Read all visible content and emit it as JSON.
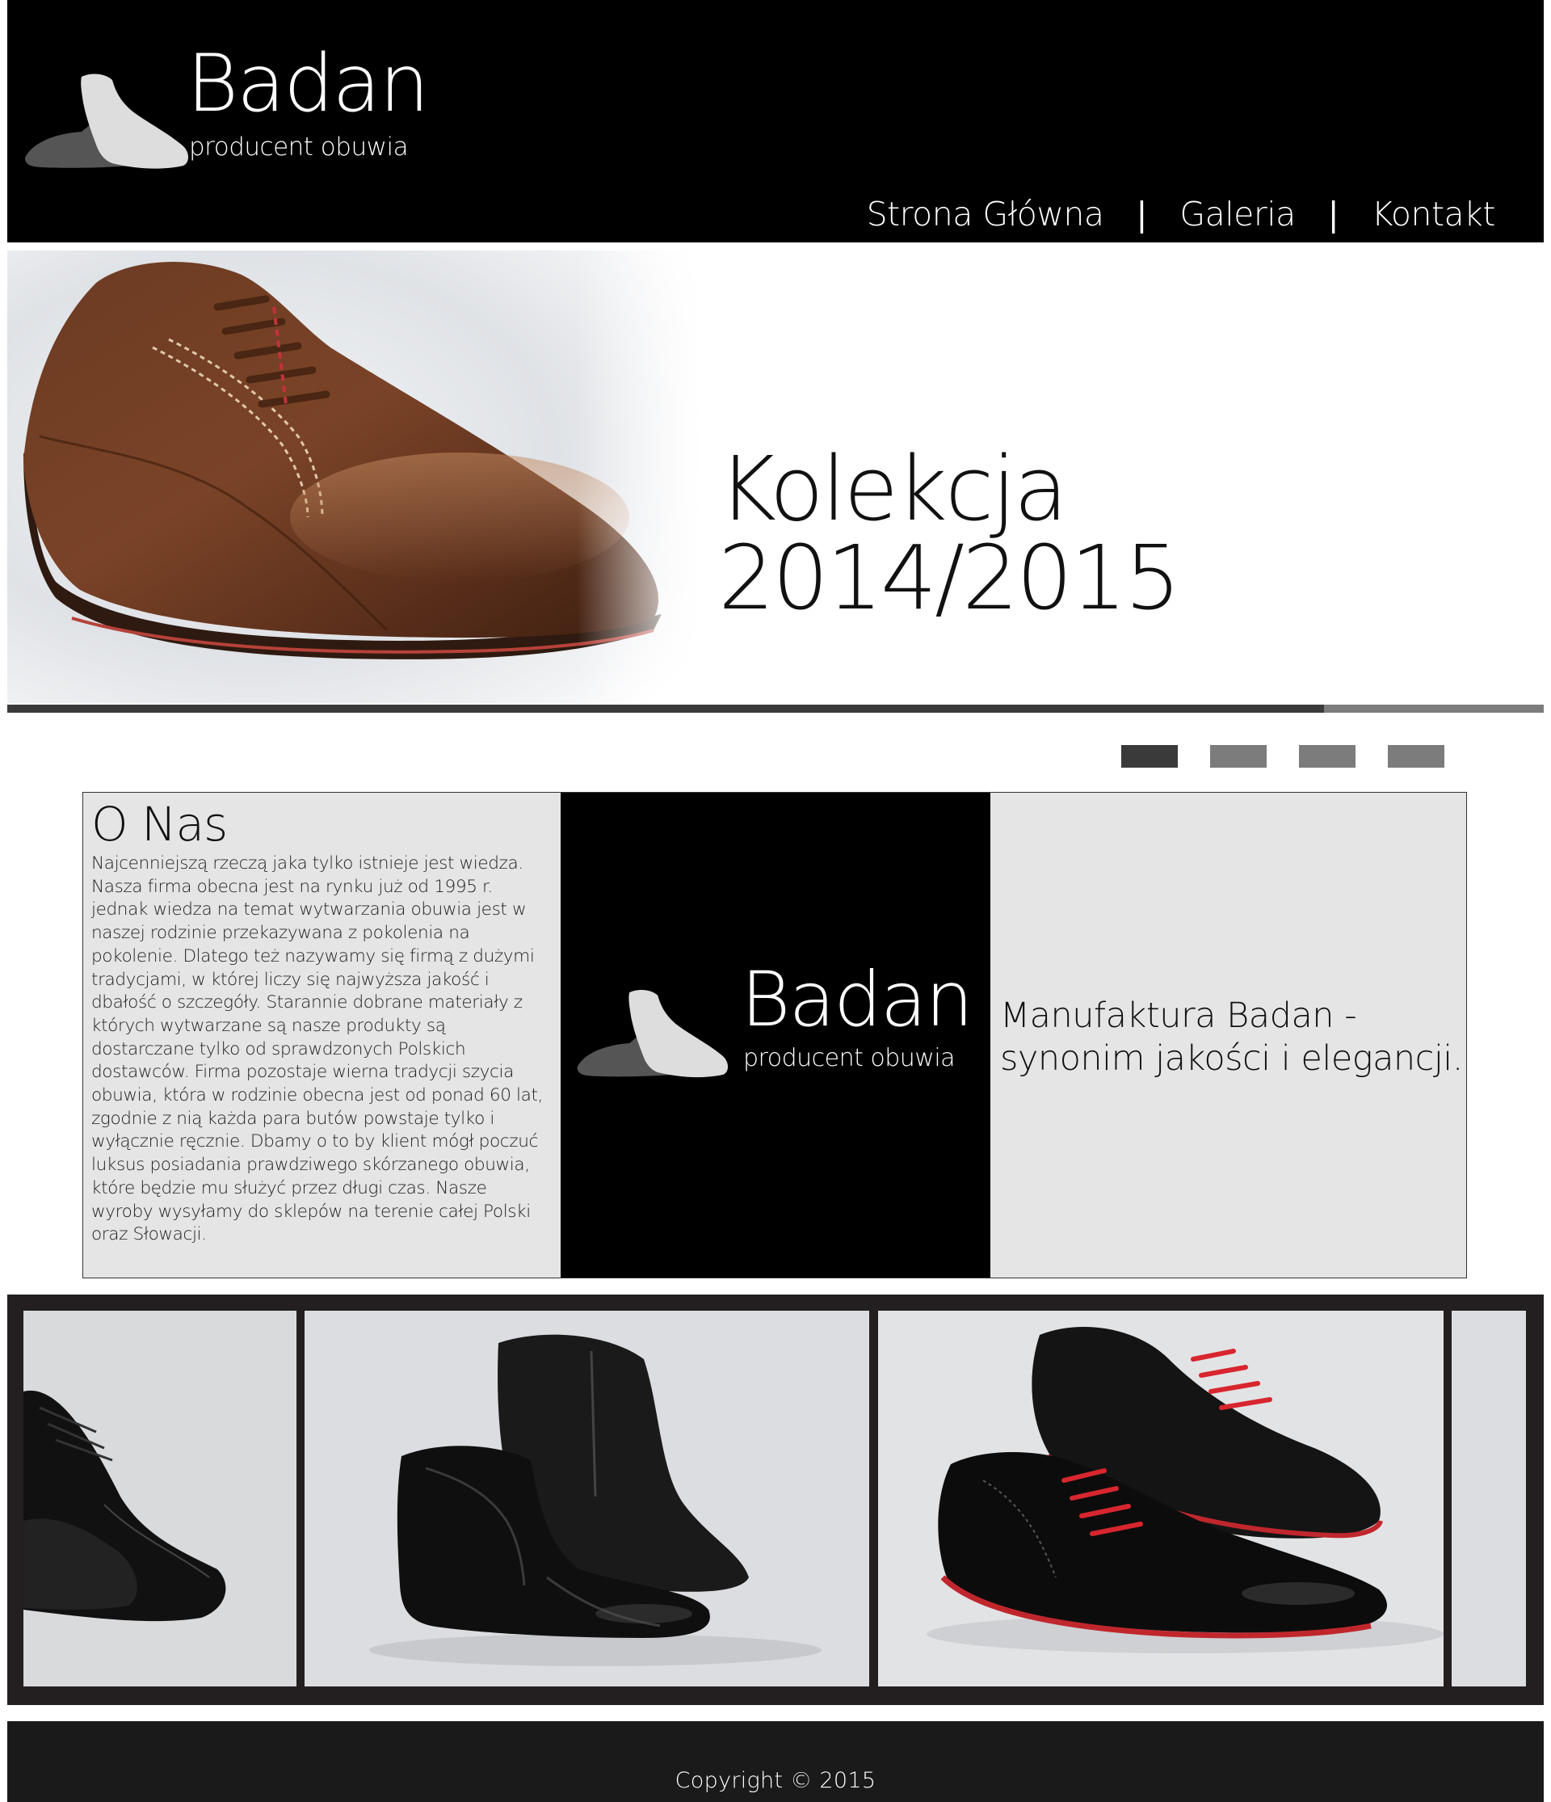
{
  "brand": {
    "name": "Badan",
    "tagline": "producent obuwia"
  },
  "nav": {
    "items": [
      {
        "label": "Strona Główna"
      },
      {
        "label": "Galeria"
      },
      {
        "label": "Kontakt"
      }
    ],
    "separator": "|"
  },
  "hero": {
    "title": "Kolekcja 2014/2015",
    "progress": 0.857
  },
  "slider": {
    "count": 4,
    "active_index": 0
  },
  "about": {
    "heading": "O Nas",
    "text": "Najcenniejszą rzeczą jaka tylko istnieje jest wiedza. Nasza firma obecna jest na rynku już od 1995 r. jednak wiedza na temat wytwarzania obuwia jest w naszej rodzinie przekazywana z pokolenia na pokolenie. Dlatego też nazywamy się firmą z dużymi tradycjami, w której liczy się najwyższa jakość i dbałość o szczegóły. Starannie dobrane materiały z których wytwarzane są nasze produkty są dostarczane tylko od sprawdzonych Polskich dostawców. Firma pozostaje wierna tradycji szycia obuwia, która w rodzinie obecna jest od ponad 60 lat, zgodnie z nią każda para butów powstaje tylko i wyłącznie ręcznie. Dbamy o to by klient mógł poczuć luksus posiadania prawdziwego skórzanego obuwia, które będzie mu służyć przez długi czas. Nasze wyroby wysyłamy do sklepów na terenie całej Polski oraz Słowacji.",
    "slogan_line1": "Manufaktura Badan -",
    "slogan_line2": "synonim jakości i elegancji."
  },
  "gallery": {
    "images": [
      {
        "name": "gallery-image-black-oxford-cropped"
      },
      {
        "name": "gallery-image-black-ankle-boots"
      },
      {
        "name": "gallery-image-black-derby-red-laces"
      },
      {
        "name": "gallery-image-partial"
      }
    ]
  },
  "footer": {
    "copyright": "Copyright © 2015"
  },
  "colors": {
    "header_bg": "#000000",
    "panel_gray": "#e5e5e5",
    "gallery_bg": "#231f20",
    "footer_bg": "#1a1a1a",
    "dot_active": "#3a3a3a",
    "dot_inactive": "#7c7c7c"
  }
}
